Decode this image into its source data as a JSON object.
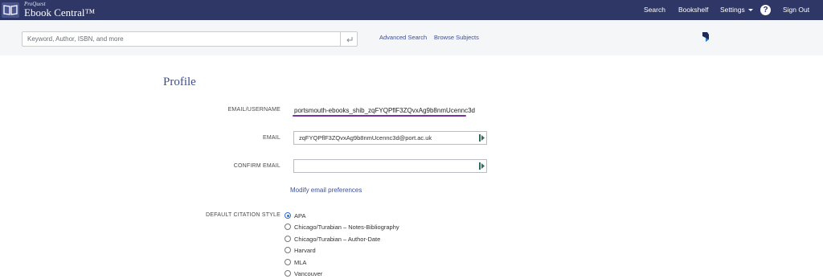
{
  "brand": {
    "small": "ProQuest",
    "name": "Ebook Central™"
  },
  "nav": {
    "search": "Search",
    "bookshelf": "Bookshelf",
    "settings": "Settings",
    "help": "?",
    "signout": "Sign Out"
  },
  "search": {
    "placeholder": "Keyword, Author, ISBN, and more",
    "advanced": "Advanced Search",
    "browse": "Browse Subjects"
  },
  "profile": {
    "title": "Profile",
    "username_label": "EMAIL/USERNAME",
    "username_value": "portsmouth-ebooks_shib_zqFYQPflF3ZQvxAg9b8nmUcennc3d",
    "email_label": "EMAIL",
    "email_value": "zqFYQPflF3ZQvxAg9b8nmUcennc3d@port.ac.uk",
    "confirm_label": "CONFIRM EMAIL",
    "confirm_value": "",
    "modify_link": "Modify email preferences",
    "citation_label": "DEFAULT CITATION STYLE",
    "citation_options": [
      {
        "label": "APA",
        "checked": true
      },
      {
        "label": "Chicago/Turabian – Notes-Bibliography",
        "checked": false
      },
      {
        "label": "Chicago/Turabian – Author-Date",
        "checked": false
      },
      {
        "label": "Harvard",
        "checked": false
      },
      {
        "label": "MLA",
        "checked": false
      },
      {
        "label": "Vancouver",
        "checked": false
      }
    ]
  },
  "colors": {
    "nav_bg": "#2e3766",
    "accent_link": "#3d4f9a",
    "underline": "#7b2fa3",
    "radio_checked": "#2b6fd6"
  }
}
